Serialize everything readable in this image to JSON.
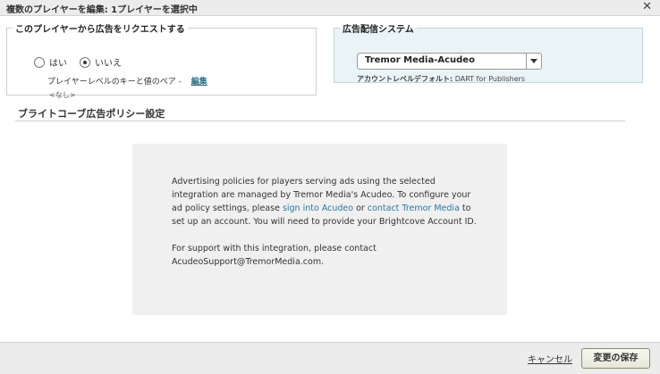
{
  "dialog": {
    "title": "複数のプレイヤーを編集: 1プレイヤーを選択中",
    "close_glyph": "✕"
  },
  "request_ads": {
    "legend": "このプレイヤーから広告をリクエストする",
    "options": [
      {
        "label": "はい",
        "checked": false
      },
      {
        "label": "いいえ",
        "checked": true
      }
    ],
    "kv_label": "プレイヤーレベルのキーと値のペア -",
    "edit_link": "編集",
    "kv_value": "<なし>"
  },
  "ad_system": {
    "legend": "広告配信システム",
    "selected": "Tremor Media-Acudeo",
    "account_label": "アカウントレベルデフォルト:",
    "account_value": "DART for Publishers"
  },
  "policy": {
    "section_title": "ブライトコーブ広告ポリシー設定",
    "text_1a": "Advertising policies for players serving ads using the selected integration are managed by Tremor Media's Acudeo. To configure your ad policy settings, please ",
    "link_signin": "sign into Acudeo",
    "text_or": " or ",
    "link_contact": "contact Tremor Media",
    "text_1b": " to set up an account. You will need to provide your Brightcove Account ID.",
    "text_2": "For support with this integration, please contact AcudeoSupport@TremorMedia.com."
  },
  "footer": {
    "cancel_label": "キャンセル",
    "save_label": "変更の保存"
  }
}
